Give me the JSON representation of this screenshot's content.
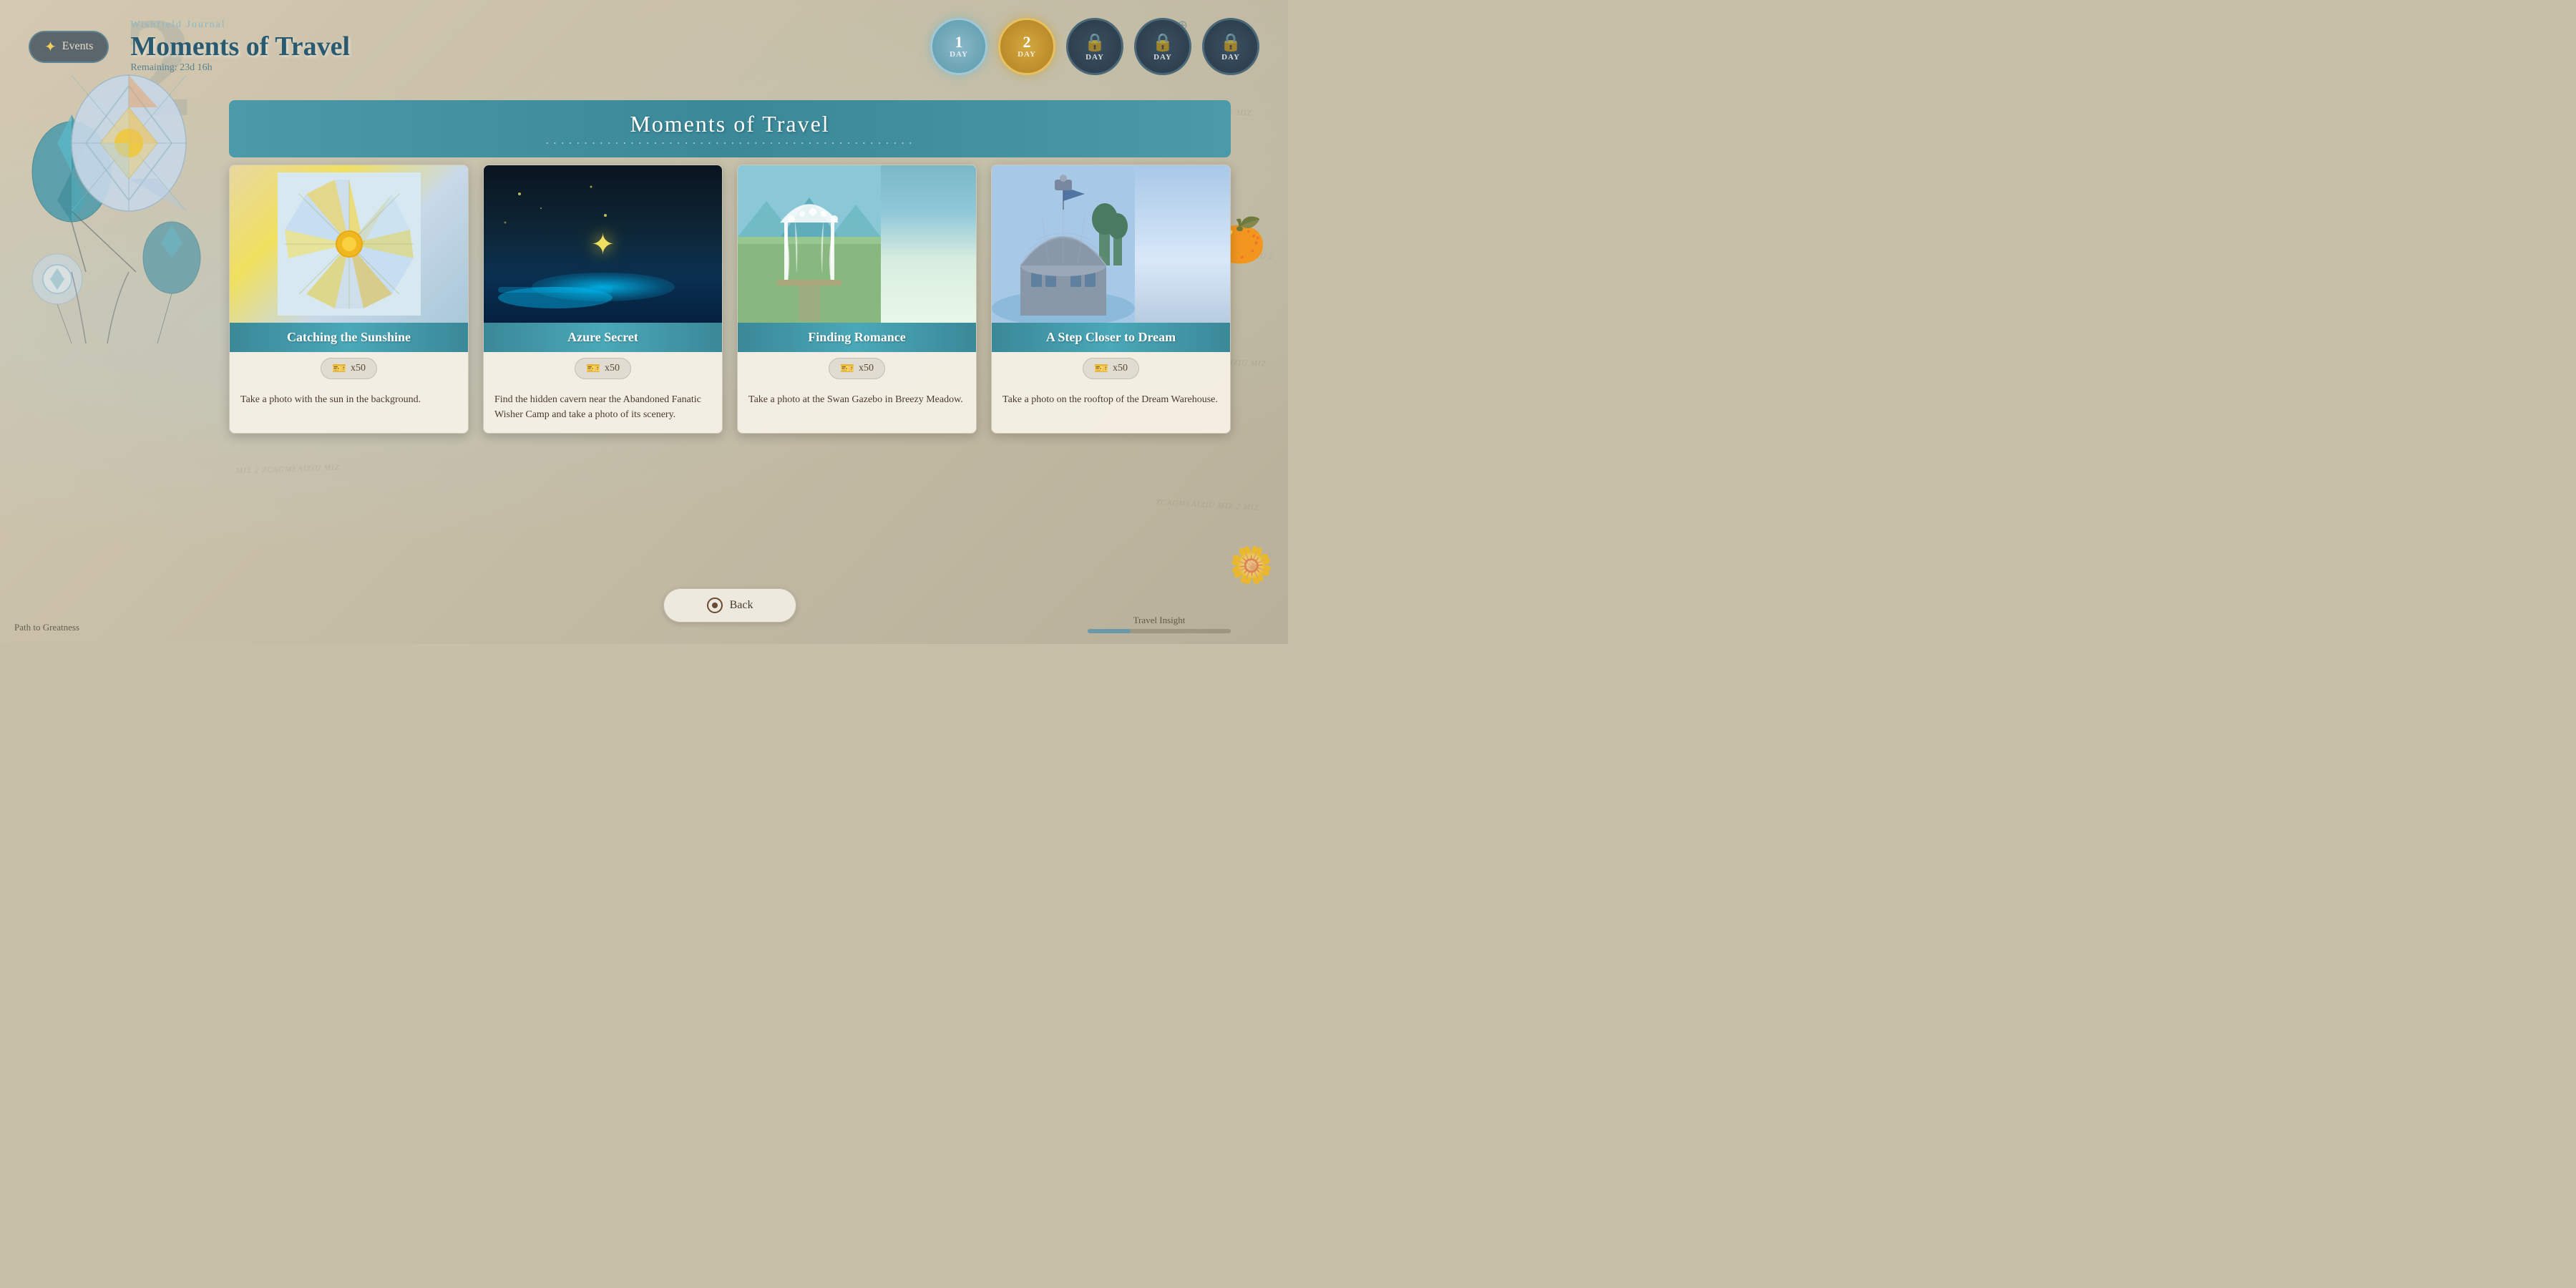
{
  "header": {
    "events_label": "Events",
    "journal_label": "Wishfield Journal",
    "main_title": "Moments of Travel",
    "remaining_label": "Remaining: 23d 16h"
  },
  "day_tabs": [
    {
      "num": "1",
      "label": "DAY",
      "state": "active-1"
    },
    {
      "num": "2",
      "label": "DAY",
      "state": "active-2"
    },
    {
      "num": "",
      "label": "DAY",
      "state": "locked"
    },
    {
      "num": "",
      "label": "DAY",
      "state": "locked"
    },
    {
      "num": "",
      "label": "DAY",
      "state": "locked"
    }
  ],
  "section_title": "Moments of Travel",
  "section_dots": "• • • • • • • • • • • • • • • • • • • • • • • • • • • • • • • • • • • • • • • • • • • • • • • •",
  "cards": [
    {
      "title": "Catching the Sunshine",
      "reward": "x50",
      "description": "Take a photo with the sun in the background."
    },
    {
      "title": "Azure Secret",
      "reward": "x50",
      "description": "Find the hidden cavern near the Abandoned Fanatic Wisher Camp and take a photo of its scenery."
    },
    {
      "title": "Finding Romance",
      "reward": "x50",
      "description": "Take a photo at the Swan Gazebo in Breezy Meadow."
    },
    {
      "title": "A Step Closer to Dream",
      "reward": "x50",
      "description": "Take a photo on the rooftop of the Dream Warehouse."
    }
  ],
  "back_button_label": "Back",
  "footer": {
    "left_text": "Path to Greatness",
    "right_text": "Travel Insight",
    "progress_value": "30"
  },
  "colors": {
    "teal": "#4a9aaa",
    "dark_teal": "#3a8898",
    "gold": "#d4a840",
    "bg": "#c8bfa8"
  }
}
